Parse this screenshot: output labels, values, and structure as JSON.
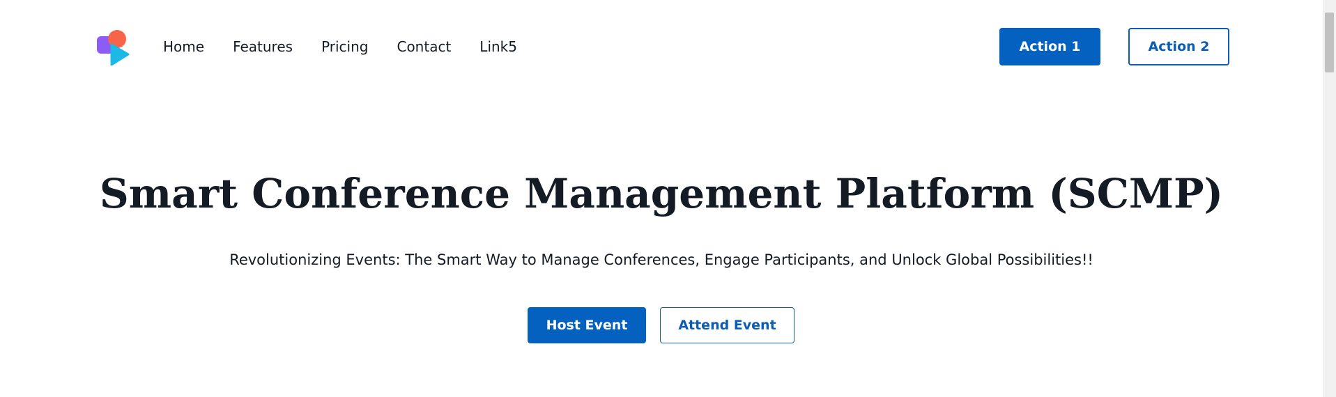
{
  "nav": {
    "links": [
      "Home",
      "Features",
      "Pricing",
      "Contact",
      "Link5"
    ],
    "action1_label": "Action 1",
    "action2_label": "Action 2"
  },
  "hero": {
    "title": "Smart Conference Management Platform (SCMP)",
    "subtitle": "Revolutionizing Events: The Smart Way to Manage Conferences, Engage Participants, and Unlock Global Possibilities!!",
    "primary_button": "Host Event",
    "secondary_button": "Attend Event"
  },
  "colors": {
    "primary": "#0561bf",
    "text": "#141b24",
    "logo_purple": "#8b5cf6",
    "logo_coral": "#f6654a",
    "logo_cyan": "#1cb8e6"
  },
  "icons": {
    "logo": "brand-logo-icon"
  }
}
